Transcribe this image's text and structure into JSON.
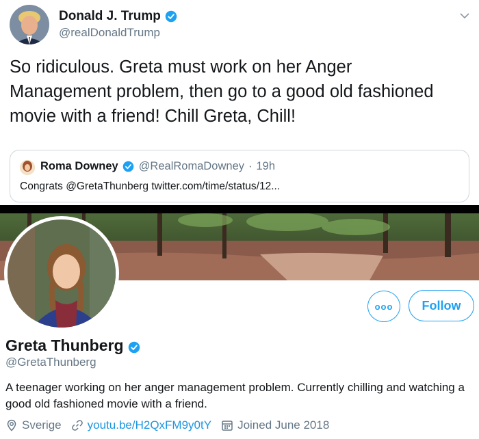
{
  "tweet": {
    "author_name": "Donald J. Trump",
    "author_handle": "@realDonaldTrump",
    "text": "So ridiculous. Greta must work on her Anger Management problem, then go to a good old fashioned movie with a friend! Chill Greta, Chill!",
    "quote": {
      "name": "Roma Downey",
      "handle": "@RealRomaDowney",
      "separator": "·",
      "time": "19h",
      "text": "Congrats @GretaThunberg twitter.com/time/status/12..."
    }
  },
  "profile": {
    "name": "Greta Thunberg",
    "handle": "@GretaThunberg",
    "bio": "A teenager working on her anger management problem. Currently chilling and watching a good old fashioned movie with a friend.",
    "location": "Sverige",
    "link": "youtu.be/H2QxFM9y0tY",
    "joined": "Joined June 2018",
    "more_label": "ooo",
    "follow_label": "Follow"
  },
  "colors": {
    "accent": "#1da1f2",
    "link": "#1b95e0",
    "secondary_text": "#657786",
    "verified": "#1da1f2",
    "border": "#ccd6dd"
  },
  "icons": {
    "verified": "verified-badge-icon",
    "caret": "chevron-down-icon",
    "location": "location-pin-icon",
    "link": "link-icon",
    "calendar": "calendar-icon"
  }
}
